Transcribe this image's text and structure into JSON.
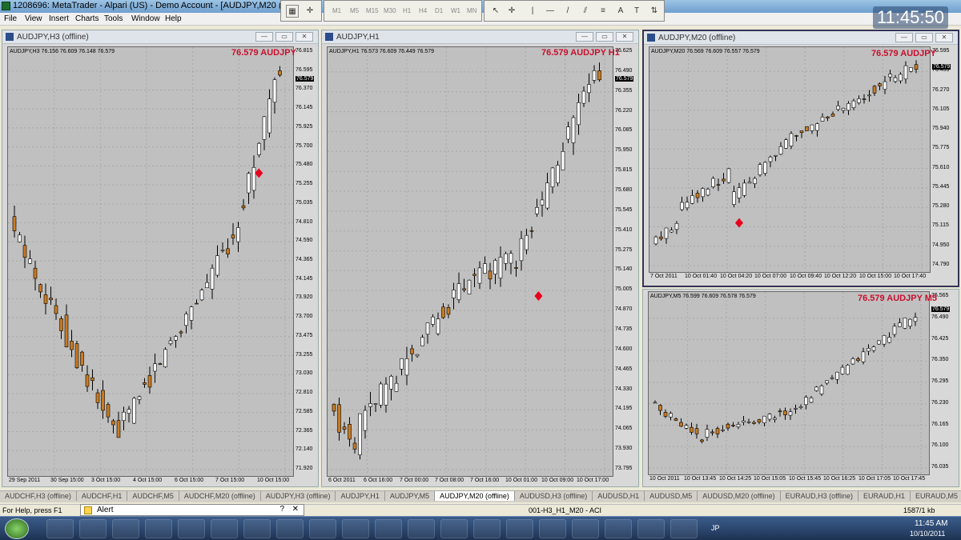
{
  "titlebar": {
    "title": "1208696: MetaTrader - Alpari (US) - Demo Account - [AUDJPY,M20 (offline)]"
  },
  "menu": [
    "File",
    "View",
    "Insert",
    "Charts",
    "Tools",
    "Window",
    "Help"
  ],
  "timeframes": [
    "M1",
    "M5",
    "M15",
    "M30",
    "H1",
    "H4",
    "D1",
    "W1",
    "MN"
  ],
  "clock": "11:45:50",
  "colors": {
    "bull": "#ffffff",
    "bear": "#c87a22",
    "wick": "#000000",
    "bg": "#c0c0c0",
    "marker": "#e8001c"
  },
  "charts": [
    {
      "title": "AUDJPY,H3 (offline)",
      "info": "AUDJPY,H3  76.156 76.609 76.148 76.579",
      "headline": "76.579 AUDJPY",
      "price": "76.579",
      "yticks": [
        "76.815",
        "76.595",
        "76.370",
        "76.145",
        "75.925",
        "75.700",
        "75.480",
        "75.255",
        "75.035",
        "74.810",
        "74.590",
        "74.365",
        "74.145",
        "73.920",
        "73.700",
        "73.475",
        "73.255",
        "73.030",
        "72.810",
        "72.585",
        "72.365",
        "72.140",
        "71.920"
      ],
      "xticks": [
        "29 Sep 2011",
        "30 Sep 15:00",
        "3 Oct 15:00",
        "4 Oct 15:00",
        "6 Oct 15:00",
        "7 Oct 15:00",
        "10 Oct 15:00"
      ]
    },
    {
      "title": "AUDJPY,H1",
      "info": "AUDJPY,H1  76.573 76.609 76.449 76.579",
      "headline": "76.579 AUDJPY H1",
      "price": "76.579",
      "yticks": [
        "76.625",
        "76.490",
        "76.355",
        "76.220",
        "76.085",
        "75.950",
        "75.815",
        "75.680",
        "75.545",
        "75.410",
        "75.275",
        "75.140",
        "75.005",
        "74.870",
        "74.735",
        "74.600",
        "74.465",
        "74.330",
        "74.195",
        "74.065",
        "73.930",
        "73.795"
      ],
      "xticks": [
        "6 Oct 2011",
        "6 Oct 16:00",
        "7 Oct 00:00",
        "7 Oct 08:00",
        "7 Oct 16:00",
        "10 Oct 01:00",
        "10 Oct 09:00",
        "10 Oct 17:00"
      ]
    },
    {
      "title": "AUDJPY,M20 (offline)",
      "info": "AUDJPY,M20  76.569 76.609 76.557 76.579",
      "headline": "76.579 AUDJPY",
      "price": "76.579",
      "yticks": [
        "76.595",
        "76.435",
        "76.270",
        "76.105",
        "75.940",
        "75.775",
        "75.610",
        "75.445",
        "75.280",
        "75.115",
        "74.950",
        "74.790"
      ],
      "xticks": [
        "7 Oct 2011",
        "10 Oct 01:40",
        "10 Oct 04:20",
        "10 Oct 07:00",
        "10 Oct 09:40",
        "10 Oct 12:20",
        "10 Oct 15:00",
        "10 Oct 17:40"
      ]
    },
    {
      "title": "",
      "info": "AUDJPY,M5  76.599 76.609 76.578 76.579",
      "headline": "76.579 AUDJPY M5",
      "price": "76.579",
      "yticks": [
        "76.565",
        "76.490",
        "76.425",
        "76.350",
        "76.295",
        "76.230",
        "76.165",
        "76.100",
        "76.035"
      ],
      "xticks": [
        "10 Oct 2011",
        "10 Oct 13:45",
        "10 Oct 14:25",
        "10 Oct 15:05",
        "10 Oct 15:45",
        "10 Oct 16:25",
        "10 Oct 17:05",
        "10 Oct 17:45"
      ]
    }
  ],
  "tabs": [
    "AUDCHF,H3 (offline)",
    "AUDCHF,H1",
    "AUDCHF,M5",
    "AUDCHF,M20 (offline)",
    "AUDJPY,H3 (offline)",
    "AUDJPY,H1",
    "AUDJPY,M5",
    "AUDJPY,M20 (offline)",
    "AUDUSD,H3 (offline)",
    "AUDUSD,H1",
    "AUDUSD,M5",
    "AUDUSD,M20 (offline)",
    "EURAUD,H3 (offline)",
    "EURAUD,H1",
    "EURAUD,M5",
    "EURAUD,M20 (off"
  ],
  "active_tab": "AUDJPY,M20 (offline)",
  "status": {
    "help": "For Help, press F1",
    "alert": "Alert",
    "profile": "001-H3_H1_M20 - ACI",
    "traffic": "1587/1 kb"
  },
  "tray": {
    "time": "11:45 AM",
    "date": "10/10/2011",
    "lang": "JP"
  }
}
